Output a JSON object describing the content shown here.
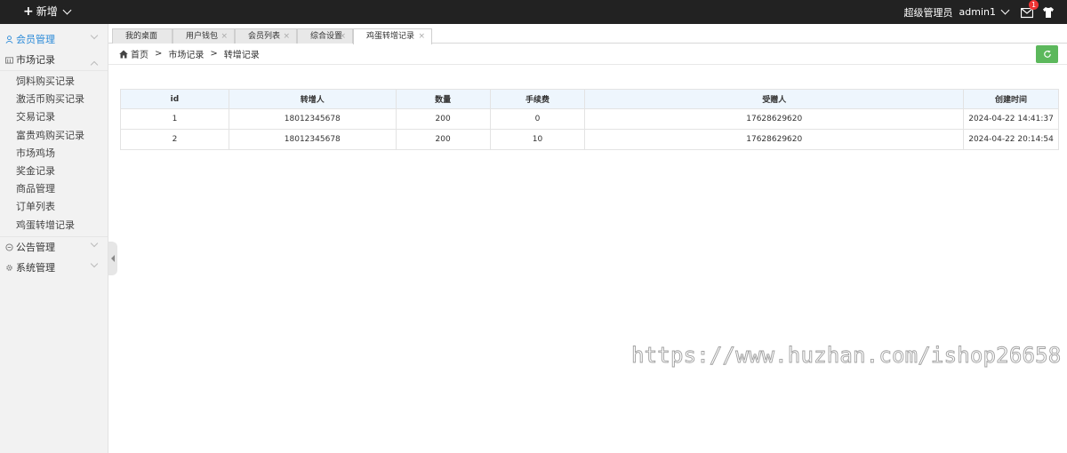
{
  "topbar": {
    "add_label": "新增",
    "role": "超级管理员",
    "username": "admin1",
    "message_count": "1"
  },
  "sidebar": {
    "groups": [
      {
        "label": "会员管理",
        "icon": "user-icon",
        "active": true
      },
      {
        "label": "市场记录",
        "icon": "market-icon",
        "expanded": true
      },
      {
        "label": "公告管理",
        "icon": "notice-icon"
      },
      {
        "label": "系统管理",
        "icon": "gear-icon"
      }
    ],
    "market_items": [
      "饲料购买记录",
      "激活币购买记录",
      "交易记录",
      "富贵鸡购买记录",
      "市场鸡场",
      "奖金记录",
      "商品管理",
      "订单列表",
      "鸡蛋转增记录"
    ]
  },
  "tabs": [
    {
      "label": "我的桌面"
    },
    {
      "label": "用户钱包"
    },
    {
      "label": "会员列表"
    },
    {
      "label": "综合设置"
    },
    {
      "label": "鸡蛋转增记录",
      "active": true
    }
  ],
  "breadcrumb": [
    "首页",
    "市场记录",
    "转增记录"
  ],
  "breadcrumb_sep": ">",
  "table": {
    "headers": [
      "id",
      "转增人",
      "数量",
      "手续费",
      "受赠人",
      "创建时间"
    ],
    "rows": [
      [
        "1",
        "18012345678",
        "200",
        "0",
        "17628629620",
        "2024-04-22 14:41:37"
      ],
      [
        "2",
        "18012345678",
        "200",
        "10",
        "17628629620",
        "2024-04-22 20:14:54"
      ]
    ]
  },
  "watermark": "https://www.huzhan.com/ishop26658",
  "colors": {
    "topbar_bg": "#222222",
    "active_menu": "#2a8ad8",
    "refresh_button": "#5cb85c",
    "table_header_bg": "#eef6fd",
    "badge": "#ee3333"
  }
}
